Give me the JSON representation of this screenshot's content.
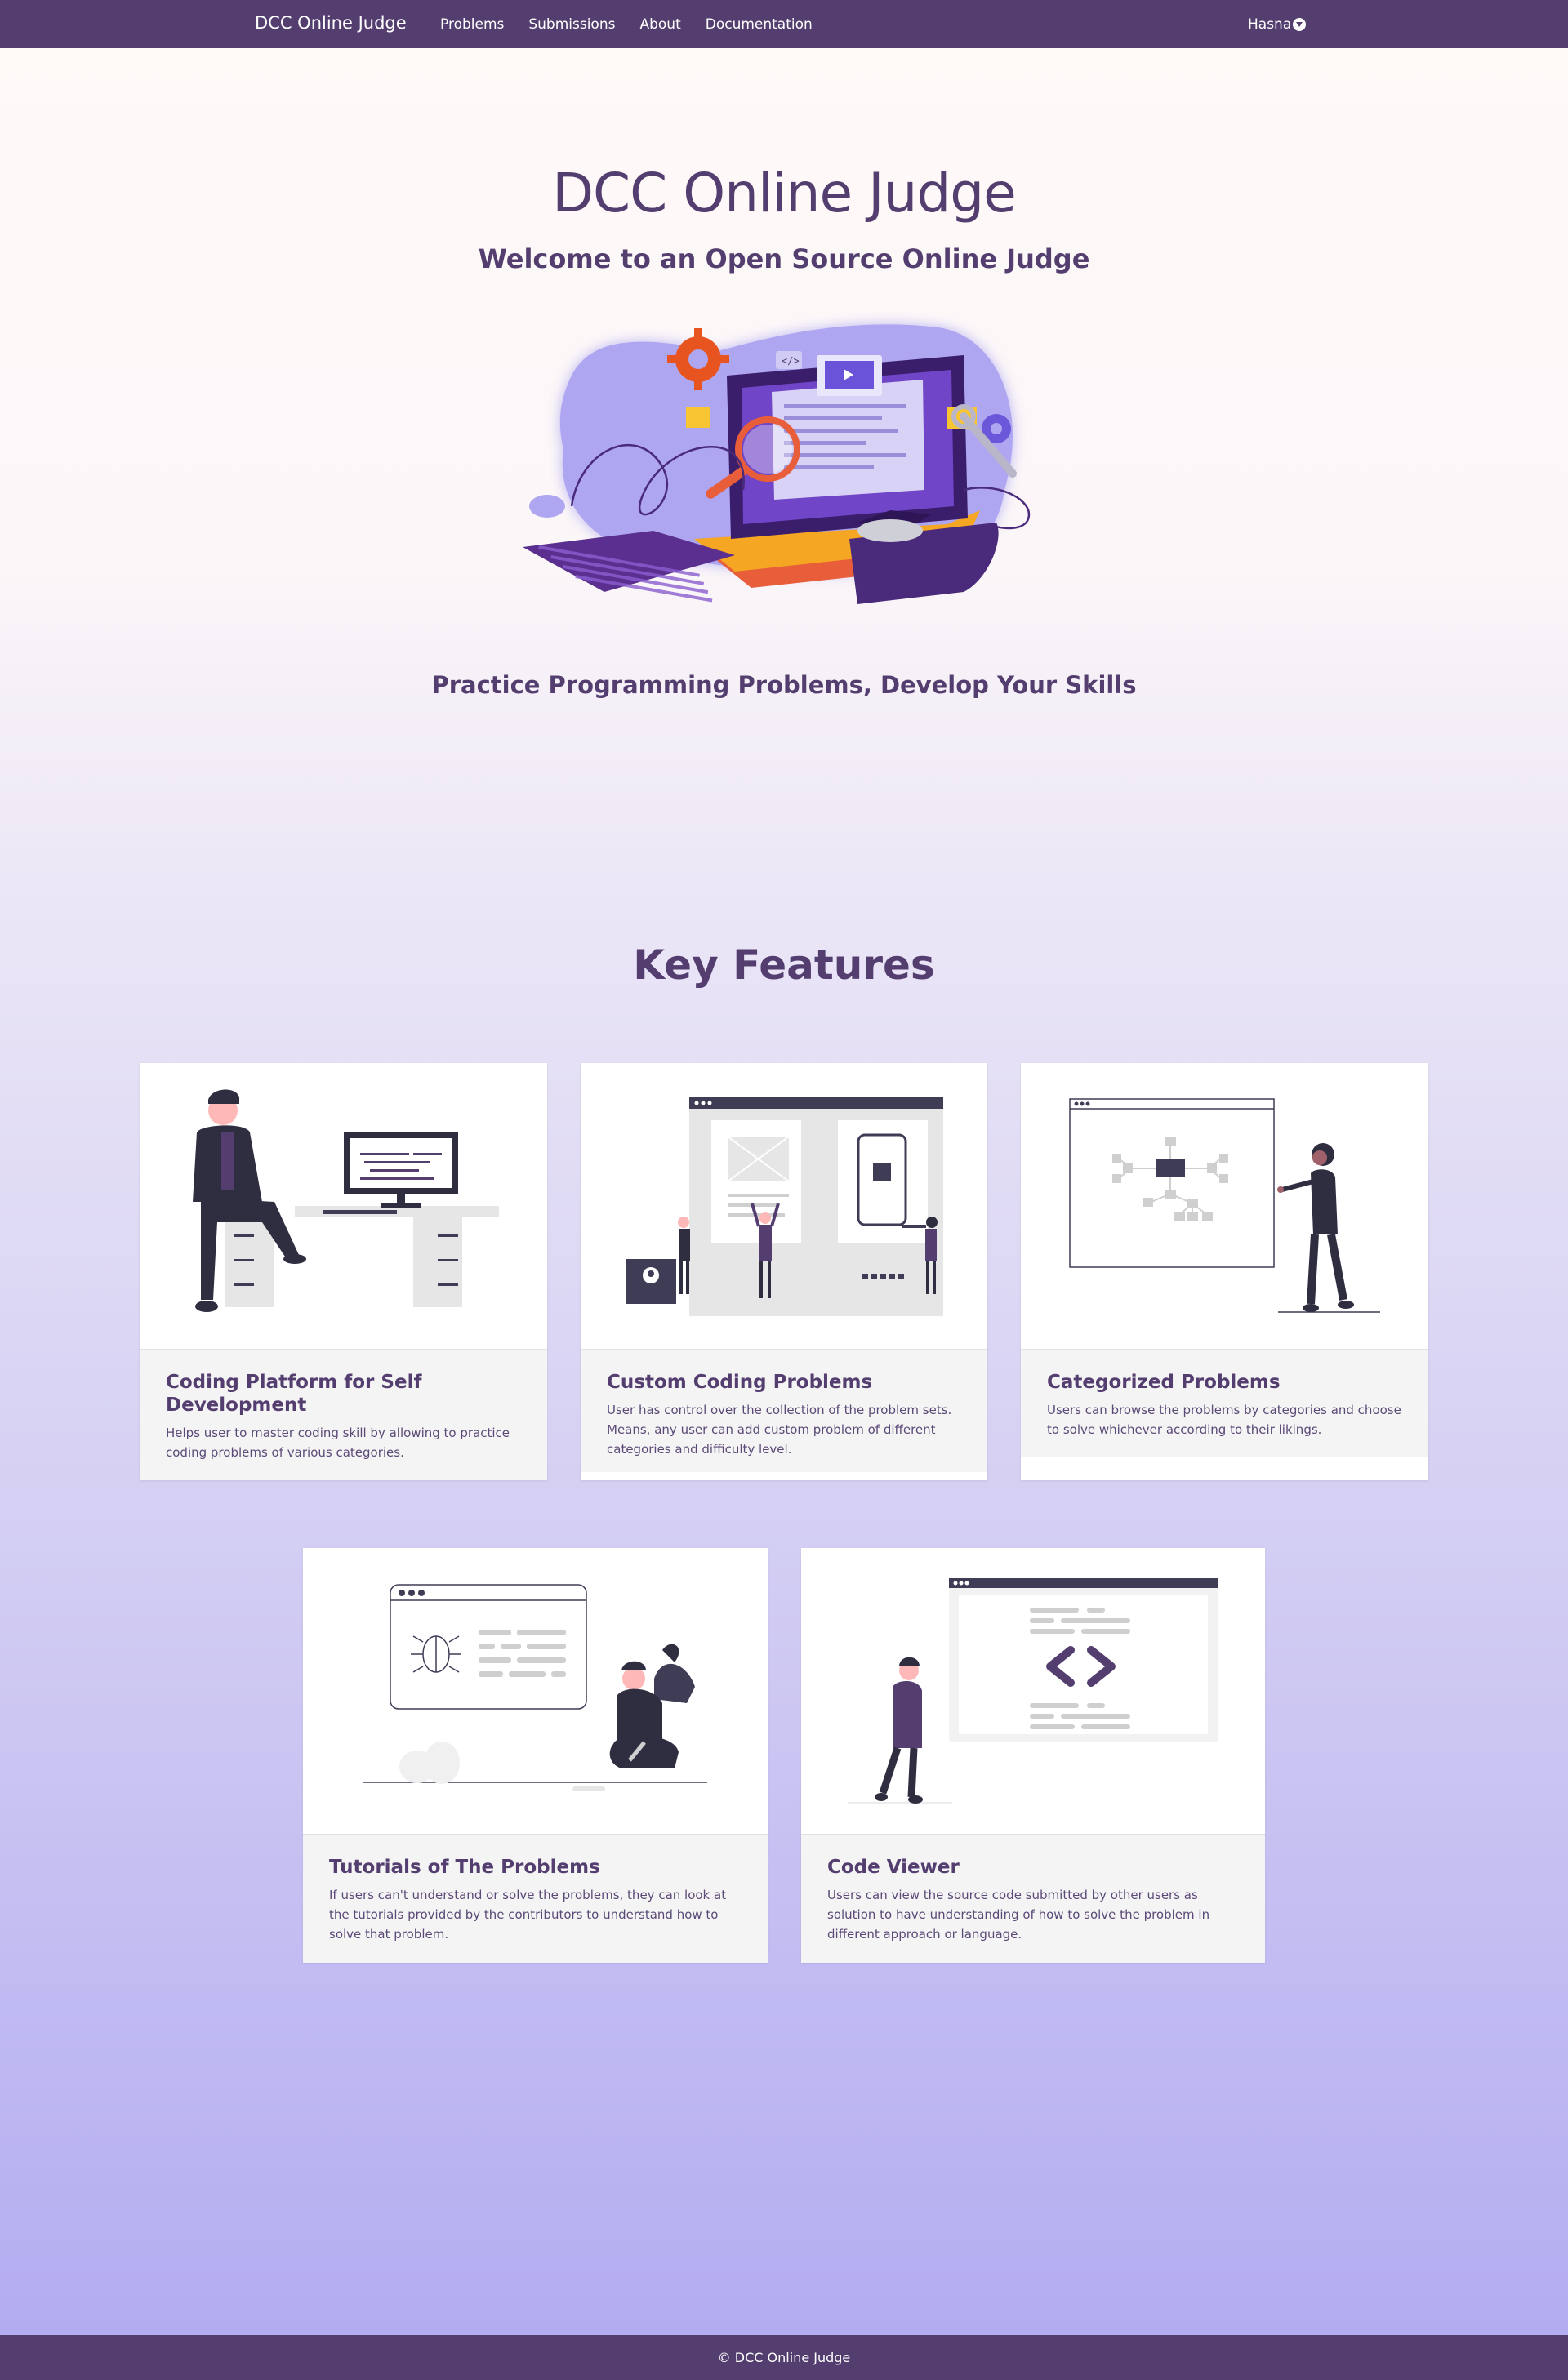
{
  "nav": {
    "brand": "DCC Online Judge",
    "links": [
      "Problems",
      "Submissions",
      "About",
      "Documentation"
    ],
    "user": "Hasna"
  },
  "hero": {
    "title": "DCC Online Judge",
    "subtitle": "Welcome to an Open Source Online Judge",
    "tagline": "Practice Programming Problems, Develop Your Skills"
  },
  "features": {
    "title": "Key Features",
    "cards": [
      {
        "title": "Coding Platform for Self Development",
        "text": "Helps user to master coding skill by allowing to practice coding problems of various categories."
      },
      {
        "title": "Custom Coding Problems",
        "text": "User has control over the collection of the problem sets. Means, any user can add custom problem of different categories and difficulty level."
      },
      {
        "title": "Categorized Problems",
        "text": "Users can browse the problems by categories and choose to solve whichever according to their likings."
      },
      {
        "title": "Tutorials of The Problems",
        "text": "If users can't understand or solve the problems, they can look at the tutorials provided by the contributors to understand how to solve that problem."
      },
      {
        "title": "Code Viewer",
        "text": "Users can view the source code submitted by other users as solution to have understanding of how to solve the problem in different approach or language."
      }
    ]
  },
  "footer": {
    "text": "© DCC Online Judge"
  }
}
